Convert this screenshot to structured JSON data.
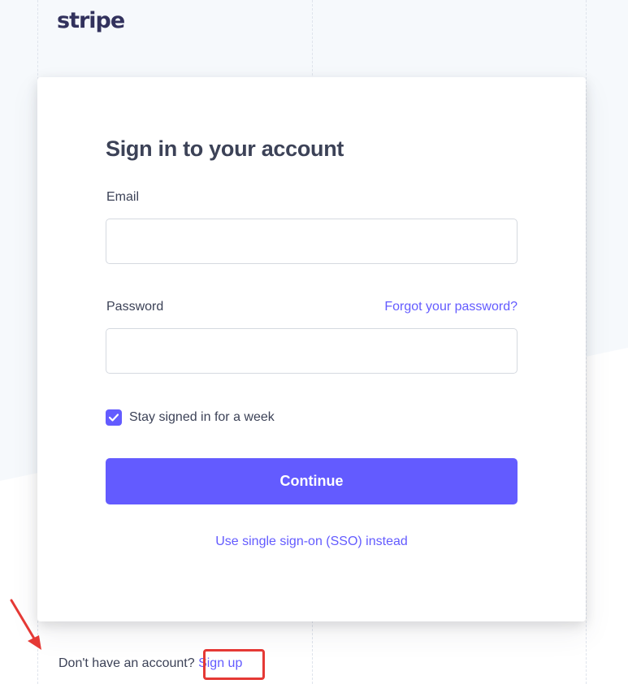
{
  "logo": {
    "text": "stripe"
  },
  "signin": {
    "title": "Sign in to your account",
    "email_label": "Email",
    "email_value": "",
    "email_placeholder": "",
    "password_label": "Password",
    "password_value": "",
    "password_placeholder": "",
    "forgot_link": "Forgot your password?",
    "stay_signed_in_label": "Stay signed in for a week",
    "stay_signed_in_checked": true,
    "continue_label": "Continue",
    "sso_link": "Use single sign-on (SSO) instead"
  },
  "footer": {
    "prompt": "Don't have an account?",
    "signup_link": "Sign up"
  },
  "annotation": {
    "arrow_icon": "arrow-icon",
    "highlight_color": "#e53935"
  },
  "colors": {
    "accent": "#635bff",
    "text": "#3c4257",
    "logo": "#32325d",
    "background_tint": "#f6f9fc"
  }
}
